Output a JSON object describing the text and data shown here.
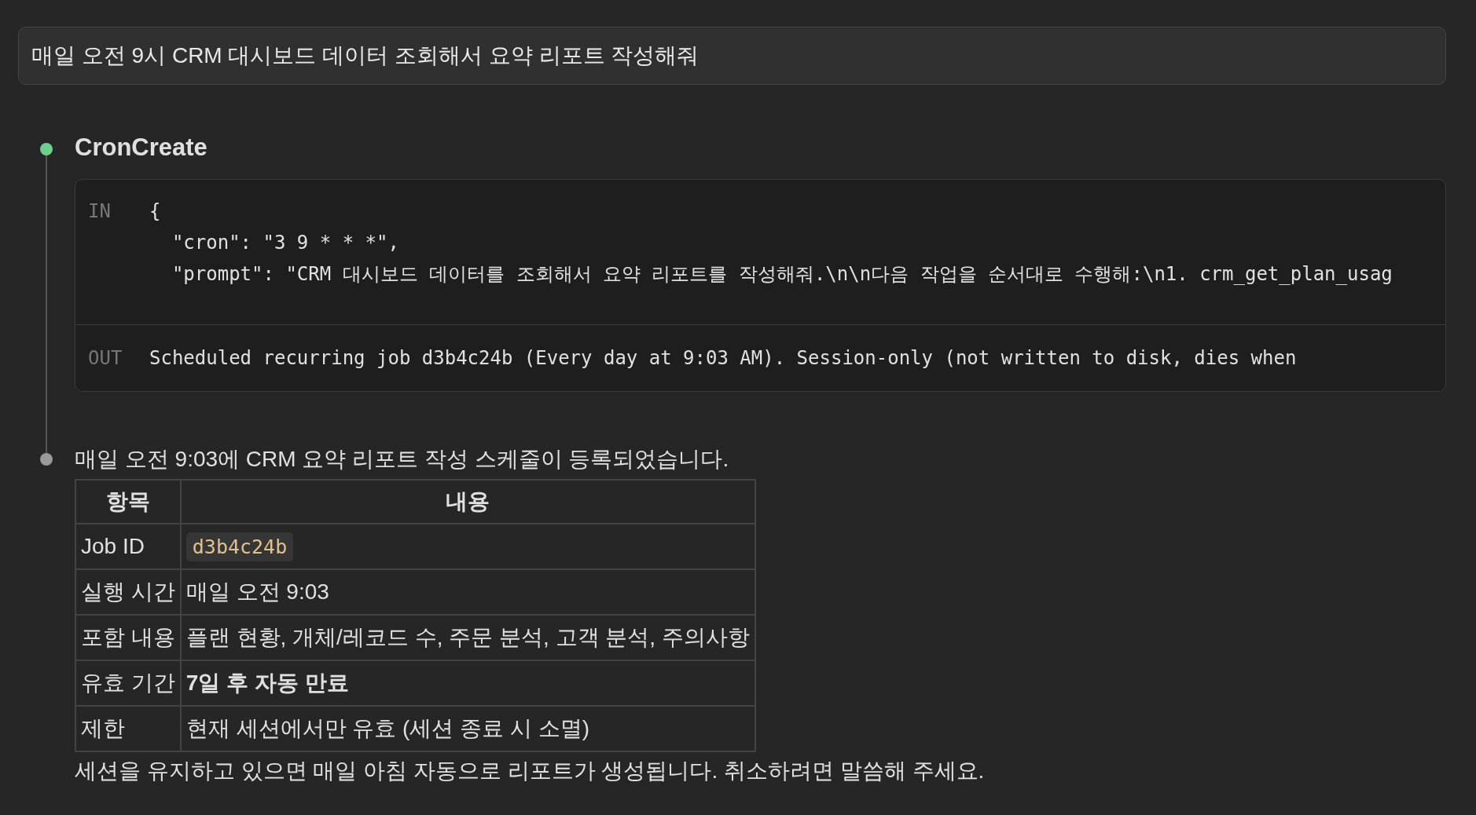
{
  "user_message": "매일 오전 9시 CRM 대시보드 데이터 조회해서 요약 리포트 작성해줘",
  "tool_call": {
    "success": true,
    "name": "CronCreate",
    "in_label": "IN",
    "in_lines": [
      "{",
      "  \"cron\": \"3 9 * * *\",",
      "  \"prompt\": \"CRM 대시보드 데이터를 조회해서 요약 리포트를 작성해줘.\\n\\n다음 작업을 순서대로 수행해:\\n1. crm_get_plan_usag"
    ],
    "out_label": "OUT",
    "out_text": "Scheduled recurring job d3b4c24b (Every day at 9:03 AM). Session-only (not written to disk, dies when"
  },
  "reply": {
    "success": false,
    "intro": "매일 오전 9:03에 CRM 요약 리포트 작성 스케줄이 등록되었습니다.",
    "table": {
      "columns": [
        "항목",
        "내용"
      ],
      "rows": [
        {
          "label": "Job ID",
          "value": "d3b4c24b",
          "kind": "code"
        },
        {
          "label": "실행 시간",
          "value": "매일 오전 9:03",
          "kind": "text"
        },
        {
          "label": "포함 내용",
          "value": "플랜 현황, 개체/레코드 수, 주문 분석, 고객 분석, 주의사항",
          "kind": "text"
        },
        {
          "label": "유효 기간",
          "value": "7일 후 자동 만료",
          "kind": "bold"
        },
        {
          "label": "제한",
          "value": "현재 세션에서만 유효 (세션 종료 시 소멸)",
          "kind": "text"
        }
      ]
    },
    "outro": "세션을 유지하고 있으면 매일 아침 자동으로 리포트가 생성됩니다. 취소하려면 말씀해 주세요."
  }
}
